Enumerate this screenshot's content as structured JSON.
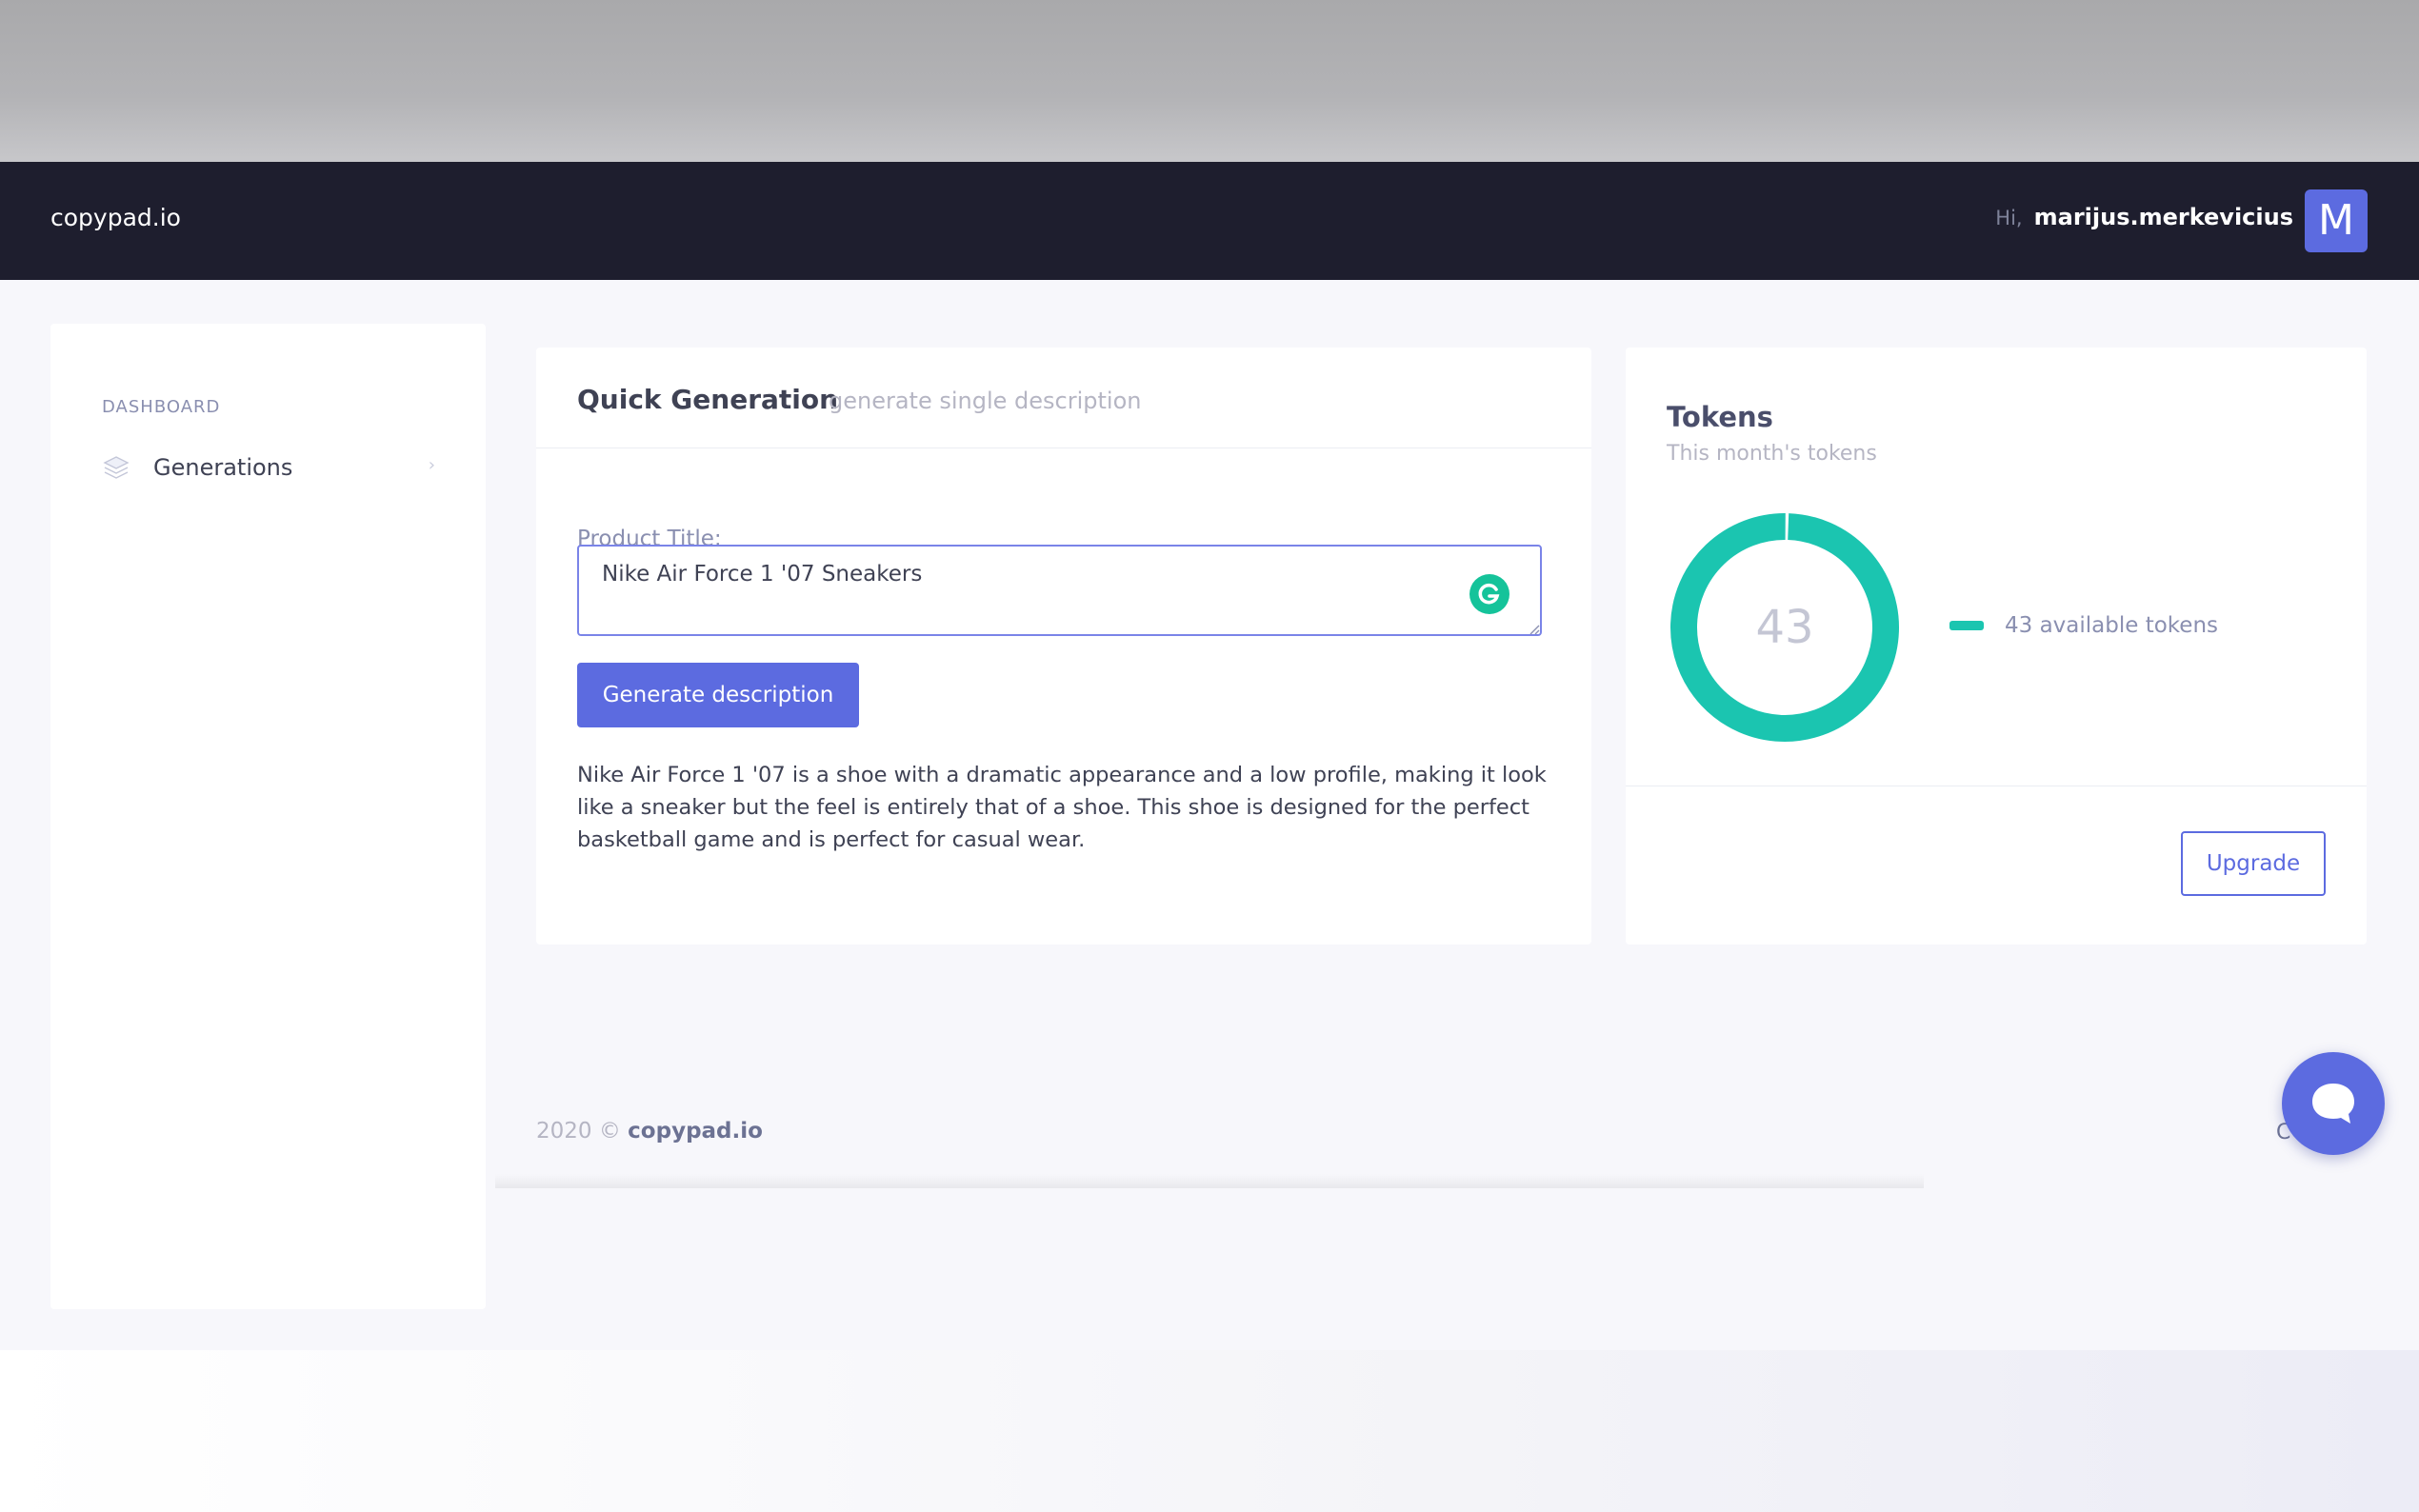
{
  "navbar": {
    "brand": "copypad.io",
    "greeting": "Hi,",
    "username": "marijus.merkevicius",
    "avatar_letter": "M"
  },
  "sidebar": {
    "section_title": "DASHBOARD",
    "items": [
      {
        "label": "Generations",
        "icon": "layers-icon"
      }
    ]
  },
  "quick_generation": {
    "title": "Quick Generation",
    "subtitle": "generate single description",
    "field_label": "Product Title:",
    "input_value": "Nike Air Force 1 '07 Sneakers",
    "button_label": "Generate description",
    "result_text": "Nike Air Force 1 '07 is a shoe with a dramatic appearance and a low profile, making it look like a sneaker but the feel is entirely that of a shoe. This shoe is designed for the perfect basketball game and is perfect for casual wear."
  },
  "tokens": {
    "title": "Tokens",
    "subtitle": "This month's tokens",
    "count": "43",
    "legend_label": "43 available tokens",
    "available_fraction": 0.995,
    "ring_color": "#1bc5b0",
    "button_label": "Upgrade"
  },
  "footer": {
    "year": "2020 ©",
    "brand": "copypad.io",
    "right_text": "C"
  },
  "colors": {
    "accent": "#5c6be0",
    "navbar_bg": "#1e1e2e",
    "teal": "#1bc5b0"
  }
}
